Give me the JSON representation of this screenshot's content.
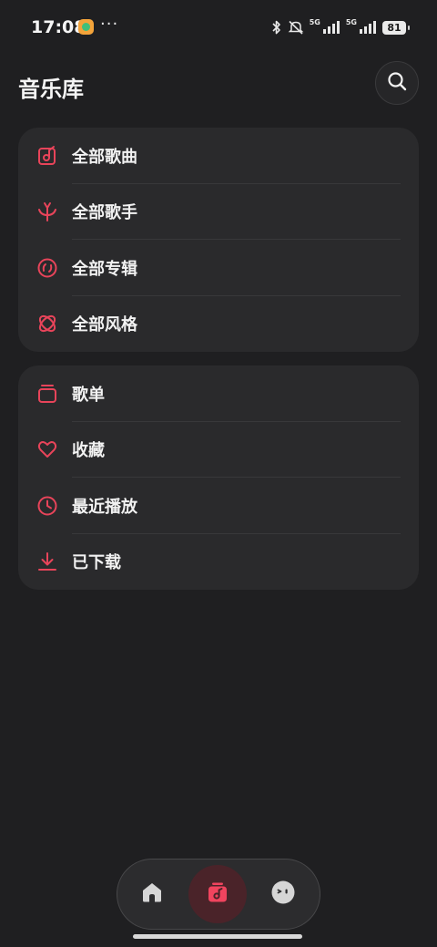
{
  "status_bar": {
    "time": "17:08",
    "dots": "···",
    "signal1_label": "5G",
    "signal2_label": "5G",
    "battery": "81"
  },
  "header": {
    "title": "音乐库"
  },
  "library_card": {
    "items": [
      {
        "label": "全部歌曲",
        "icon": "song-icon"
      },
      {
        "label": "全部歌手",
        "icon": "artist-icon"
      },
      {
        "label": "全部专辑",
        "icon": "album-icon"
      },
      {
        "label": "全部风格",
        "icon": "genre-icon"
      }
    ]
  },
  "personal_card": {
    "items": [
      {
        "label": "歌单",
        "icon": "playlist-icon"
      },
      {
        "label": "收藏",
        "icon": "heart-icon"
      },
      {
        "label": "最近播放",
        "icon": "clock-icon"
      },
      {
        "label": "已下载",
        "icon": "download-icon"
      }
    ]
  },
  "bottom_nav": {
    "items": [
      "home-icon",
      "music-library-icon",
      "profile-icon"
    ],
    "active": "music-library-icon"
  },
  "colors": {
    "background": "#1f1f21",
    "card": "#2a2a2c",
    "accent": "#e8445a",
    "text": "#f2f2f2"
  }
}
